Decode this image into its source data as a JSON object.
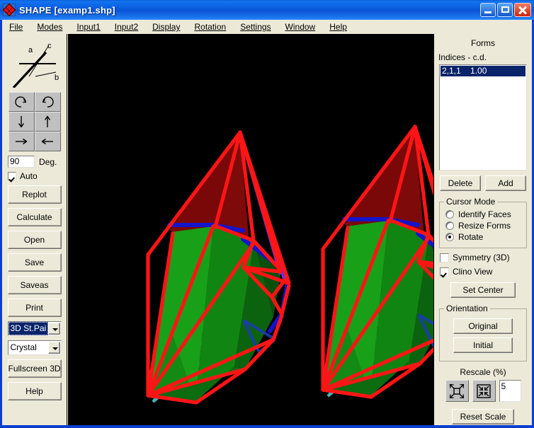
{
  "window": {
    "title": "SHAPE [examp1.shp]",
    "icon": "shape-app-icon",
    "buttons": {
      "minimize": "minimize-button",
      "maximize": "maximize-button",
      "close": "close-button"
    }
  },
  "menubar": {
    "items": [
      {
        "label": "File",
        "accel": "F"
      },
      {
        "label": "Modes",
        "accel": "M"
      },
      {
        "label": "Input1",
        "accel": "1"
      },
      {
        "label": "Input2",
        "accel": "2"
      },
      {
        "label": "Display",
        "accel": "D"
      },
      {
        "label": "Rotation",
        "accel": "R"
      },
      {
        "label": "Settings",
        "accel": "S"
      },
      {
        "label": "Window",
        "accel": "W"
      },
      {
        "label": "Help",
        "accel": "H"
      }
    ]
  },
  "leftbar": {
    "axes": {
      "labels": [
        "a",
        "c",
        "b"
      ]
    },
    "rotation_buttons": [
      {
        "name": "rotate-ccw-button",
        "icon": "rotate-ccw-icon"
      },
      {
        "name": "rotate-cw-button",
        "icon": "rotate-cw-icon"
      },
      {
        "name": "rotate-down-button",
        "icon": "arrow-down-icon"
      },
      {
        "name": "rotate-up-button",
        "icon": "arrow-up-icon"
      },
      {
        "name": "rotate-right-button",
        "icon": "arrow-right-icon"
      },
      {
        "name": "rotate-left-button",
        "icon": "arrow-left-icon"
      }
    ],
    "degrees": {
      "value": "90",
      "label": "Deg."
    },
    "auto": {
      "label": "Auto",
      "checked": true
    },
    "buttons": [
      {
        "name": "replot-button",
        "label": "Replot"
      },
      {
        "name": "calculate-button",
        "label": "Calculate"
      },
      {
        "name": "open-button",
        "label": "Open"
      },
      {
        "name": "save-button",
        "label": "Save"
      },
      {
        "name": "saveas-button",
        "label": "Saveas"
      },
      {
        "name": "print-button",
        "label": "Print"
      }
    ],
    "view_mode_combo": {
      "value": "3D St.Pai",
      "selected": true
    },
    "object_combo": {
      "value": "Crystal",
      "selected": false
    },
    "fullscreen_button": {
      "label": "Fullscreen 3D"
    },
    "help_button": {
      "label": "Help"
    }
  },
  "rightbar": {
    "forms": {
      "title": "Forms",
      "subtitle": "Indices - c.d.",
      "items": [
        {
          "indices": "2,1,1",
          "cd": "1.00",
          "text": "2,1,1    1.00",
          "selected": true
        }
      ],
      "delete_label": "Delete",
      "add_label": "Add"
    },
    "cursor_mode": {
      "legend": "Cursor Mode",
      "options": [
        {
          "label": "Identify Faces",
          "selected": false
        },
        {
          "label": "Resize Forms",
          "selected": false
        },
        {
          "label": "Rotate",
          "selected": true
        }
      ]
    },
    "symmetry": {
      "label": "Symmetry (3D)",
      "checked": false
    },
    "clino": {
      "label": "Clino View",
      "checked": true
    },
    "set_center_label": "Set Center",
    "orientation": {
      "legend": "Orientation",
      "original_label": "Original",
      "initial_label": "Initial"
    },
    "rescale": {
      "title": "Rescale (%)",
      "expand_icon": "expand-arrows-icon",
      "shrink_icon": "shrink-arrows-icon",
      "value": "5",
      "reset_label": "Reset Scale"
    }
  },
  "canvas": {
    "background": "#000000",
    "stereo_pair": true,
    "colors": {
      "edge": "#ff1515",
      "face_red": "#8c0a0a",
      "face_green": "#149414",
      "face_green_dark": "#0a5c14",
      "edge_blue": "#1414cc",
      "edge_cyan": "#49b4b4",
      "edge_purple": "#7d2bc4"
    }
  }
}
